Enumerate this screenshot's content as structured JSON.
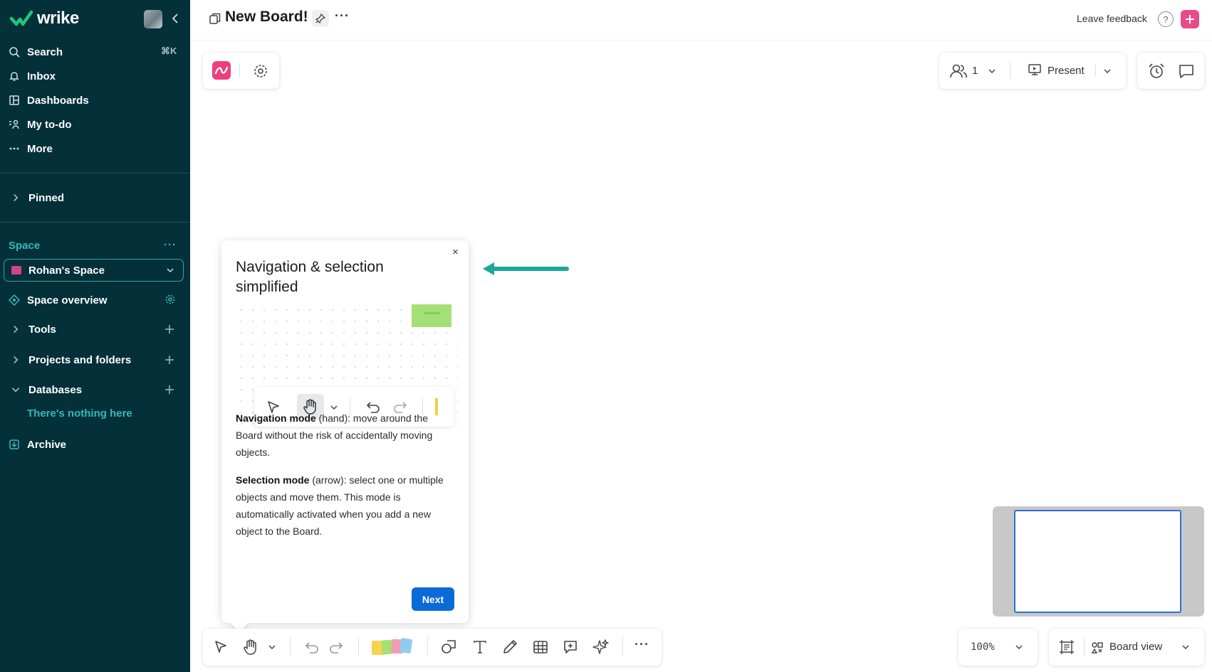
{
  "brand": {
    "name": "wrike"
  },
  "sidebar": {
    "search_label": "Search",
    "search_shortcut": "⌘K",
    "inbox_label": "Inbox",
    "dashboards_label": "Dashboards",
    "todo_label": "My to-do",
    "more_label": "More",
    "pinned_label": "Pinned",
    "space_heading": "Space",
    "space_dots": "···",
    "space_name": "Rohan's Space",
    "space_overview_label": "Space overview",
    "tools_label": "Tools",
    "projects_label": "Projects and folders",
    "databases_label": "Databases",
    "databases_empty": "There's nothing here",
    "archive_label": "Archive"
  },
  "header": {
    "title": "New Board!",
    "more": "···",
    "leave_feedback": "Leave feedback",
    "help": "?"
  },
  "top_right": {
    "participants_count": "1",
    "present_label": "Present"
  },
  "tooltip": {
    "close": "×",
    "title": "Navigation & selection simplified",
    "nav_mode_label": "Navigation mode",
    "nav_mode_text": " (hand): move around the Board without the risk of accidentally moving objects.",
    "sel_mode_label": "Selection mode",
    "sel_mode_text": " (arrow): select one or multiple objects and move them. This mode is automatically activated when you add a new object to the Board.",
    "next_label": "Next"
  },
  "bottom": {
    "more": "···",
    "zoom": "100%",
    "board_view_label": "Board view"
  },
  "colors": {
    "sidebar_bg": "#04303a",
    "accent_teal": "#39b8b8",
    "brand_pink": "#e94a8c",
    "primary_blue": "#0a6bd6"
  }
}
